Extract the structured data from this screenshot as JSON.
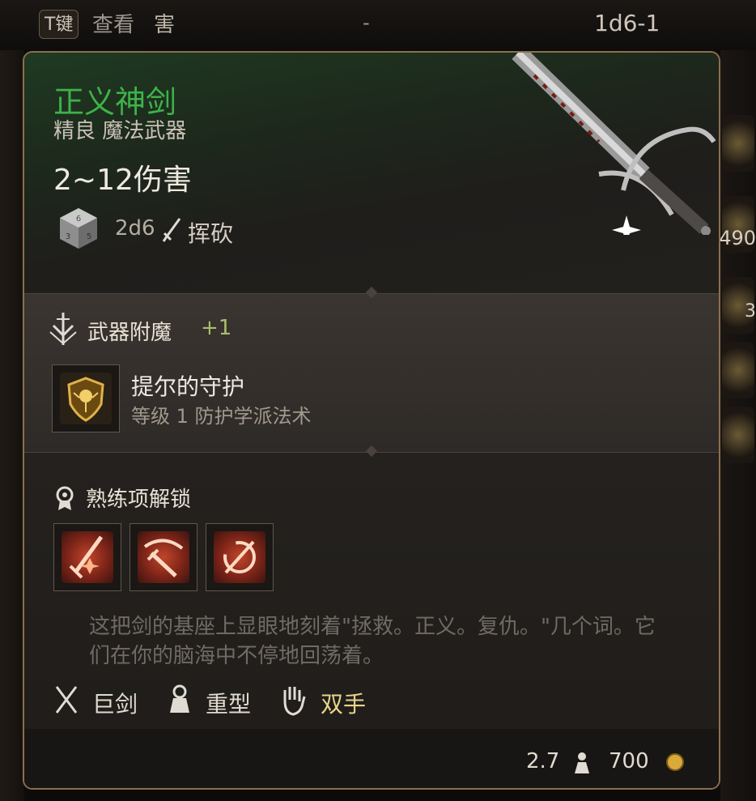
{
  "topbar": {
    "hotkey": "T键",
    "view_label": "查看",
    "view_item": "害",
    "dash": "-",
    "dice": "1d6-1"
  },
  "right_panel": {
    "count_1": "490",
    "count_2": "3"
  },
  "item": {
    "name": "正义神剑",
    "rarity_type": "精良 魔法武器",
    "damage": "2~12伤害",
    "damage_dice": "2d6",
    "damage_type": "挥砍",
    "name_color": "#3db24a"
  },
  "enchantment": {
    "title": "武器附魔",
    "bonus": "+1",
    "spell_name": "提尔的守护",
    "spell_desc": "等级 1 防护学派法术"
  },
  "proficiency": {
    "title": "熟练项解锁",
    "actions": [
      "weapon-action-1-icon",
      "weapon-action-2-icon",
      "weapon-action-3-icon"
    ]
  },
  "flavor_text": "这把剑的基座上显眼地刻着\"拯救。正义。复仇。\"几个词。它们在你的脑海中不停地回荡着。",
  "properties": {
    "type": "巨剑",
    "weight_class": "重型",
    "handedness": "双手"
  },
  "footer": {
    "weight": "2.7",
    "price": "700"
  }
}
